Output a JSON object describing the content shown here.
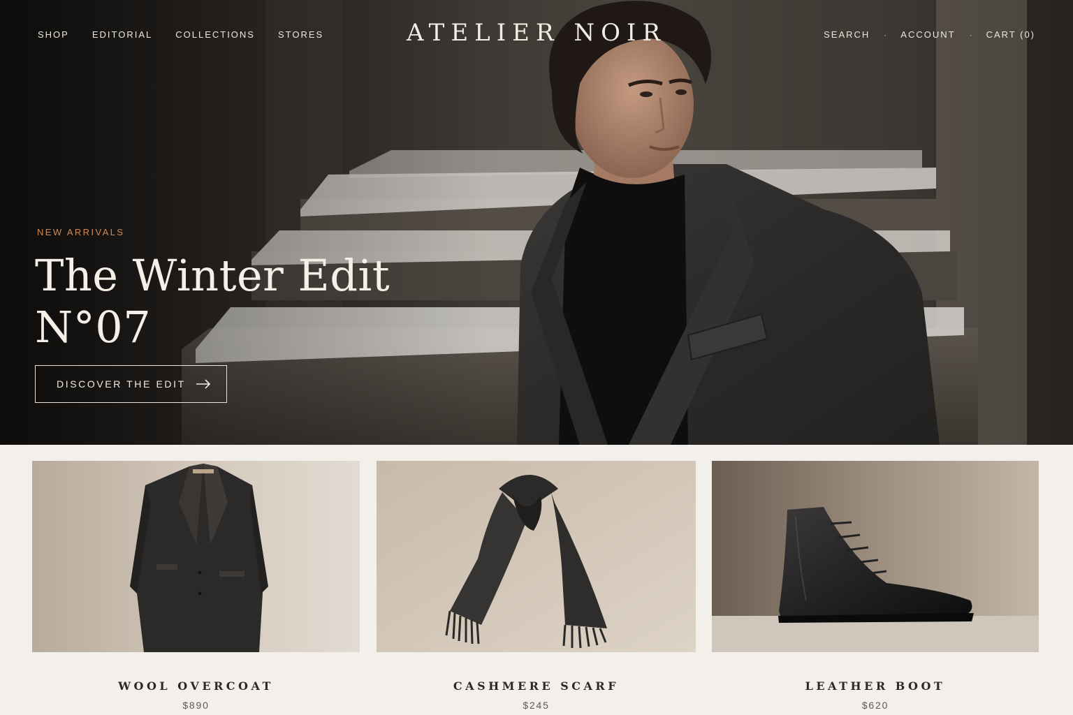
{
  "brand": {
    "name": "ATELIER NOIR"
  },
  "nav": {
    "left": [
      "SHOP",
      "EDITORIAL",
      "COLLECTIONS",
      "STORES"
    ],
    "search": "SEARCH",
    "account": "ACCOUNT",
    "cart": "CART (0)",
    "separator": "·"
  },
  "hero": {
    "eyebrow": "NEW ARRIVALS",
    "title_line1": "The Winter Edit",
    "title_line2": "N°07",
    "cta_label": "DISCOVER THE EDIT",
    "cta_icon": "arrow-right-icon"
  },
  "products": [
    {
      "name": "WOOL OVERCOAT",
      "price": "$890",
      "image": "wool-overcoat"
    },
    {
      "name": "CASHMERE SCARF",
      "price": "$245",
      "image": "cashmere-scarf"
    },
    {
      "name": "LEATHER BOOT",
      "price": "$620",
      "image": "leather-boot"
    }
  ],
  "colors": {
    "accent": "#d08a55",
    "page_bg": "#f3f0eb",
    "hero_text": "#f2ede5",
    "product_text": "#2b2826"
  }
}
